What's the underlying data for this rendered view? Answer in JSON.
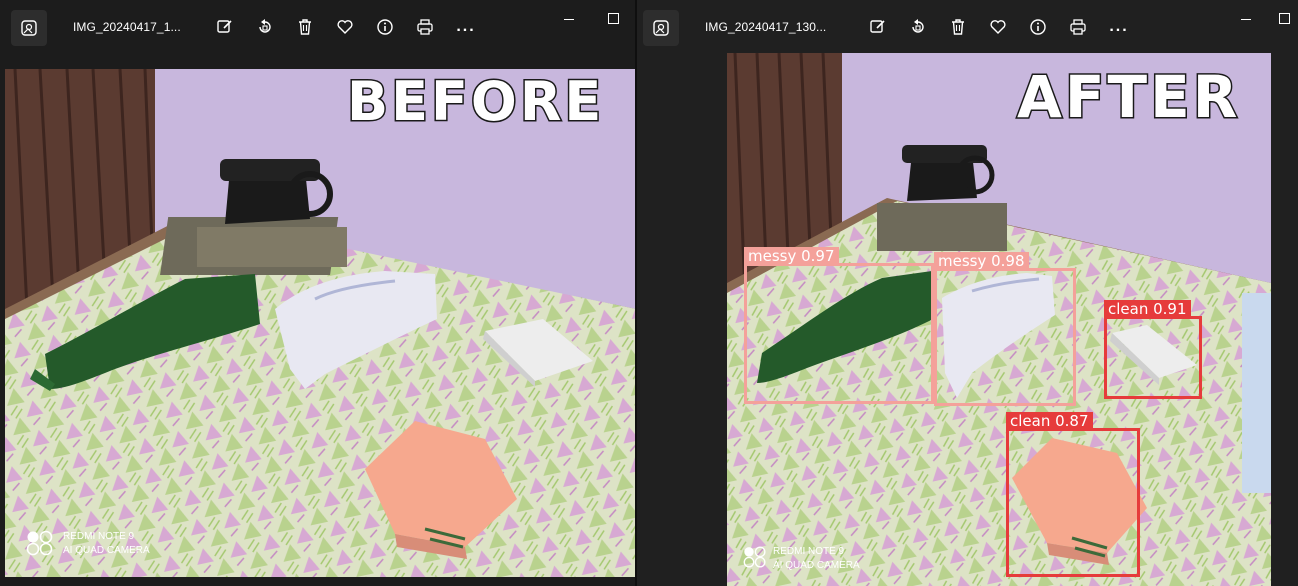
{
  "left_window": {
    "filename": "IMG_20240417_1...",
    "banner": "BEFORE",
    "watermark": {
      "line1": "REDMI NOTE 9",
      "line2": "AI QUAD CAMERA"
    },
    "toolbar": [
      "edit-icon",
      "rotate-icon",
      "delete-icon",
      "favorite-icon",
      "info-icon",
      "print-icon",
      "more-icon"
    ],
    "more_label": "..."
  },
  "right_window": {
    "filename": "IMG_20240417_130...",
    "banner": "AFTER",
    "watermark": {
      "line1": "REDMI NOTE 9",
      "line2": "AI QUAD CAMERA"
    },
    "toolbar": [
      "edit-icon",
      "rotate-icon",
      "delete-icon",
      "favorite-icon",
      "info-icon",
      "print-icon",
      "more-icon"
    ],
    "more_label": "...",
    "detections": [
      {
        "label": "messy 0.97",
        "color": "#f4a19a"
      },
      {
        "label": "messy 0.98",
        "color": "#f4a19a"
      },
      {
        "label": "clean 0.91",
        "color": "#e63b3b"
      },
      {
        "label": "clean 0.87",
        "color": "#e63b3b"
      }
    ]
  },
  "colors": {
    "titlebar": "#1c1c1c",
    "wall": "#c9b8de",
    "mattress": "#d9e1c2"
  }
}
